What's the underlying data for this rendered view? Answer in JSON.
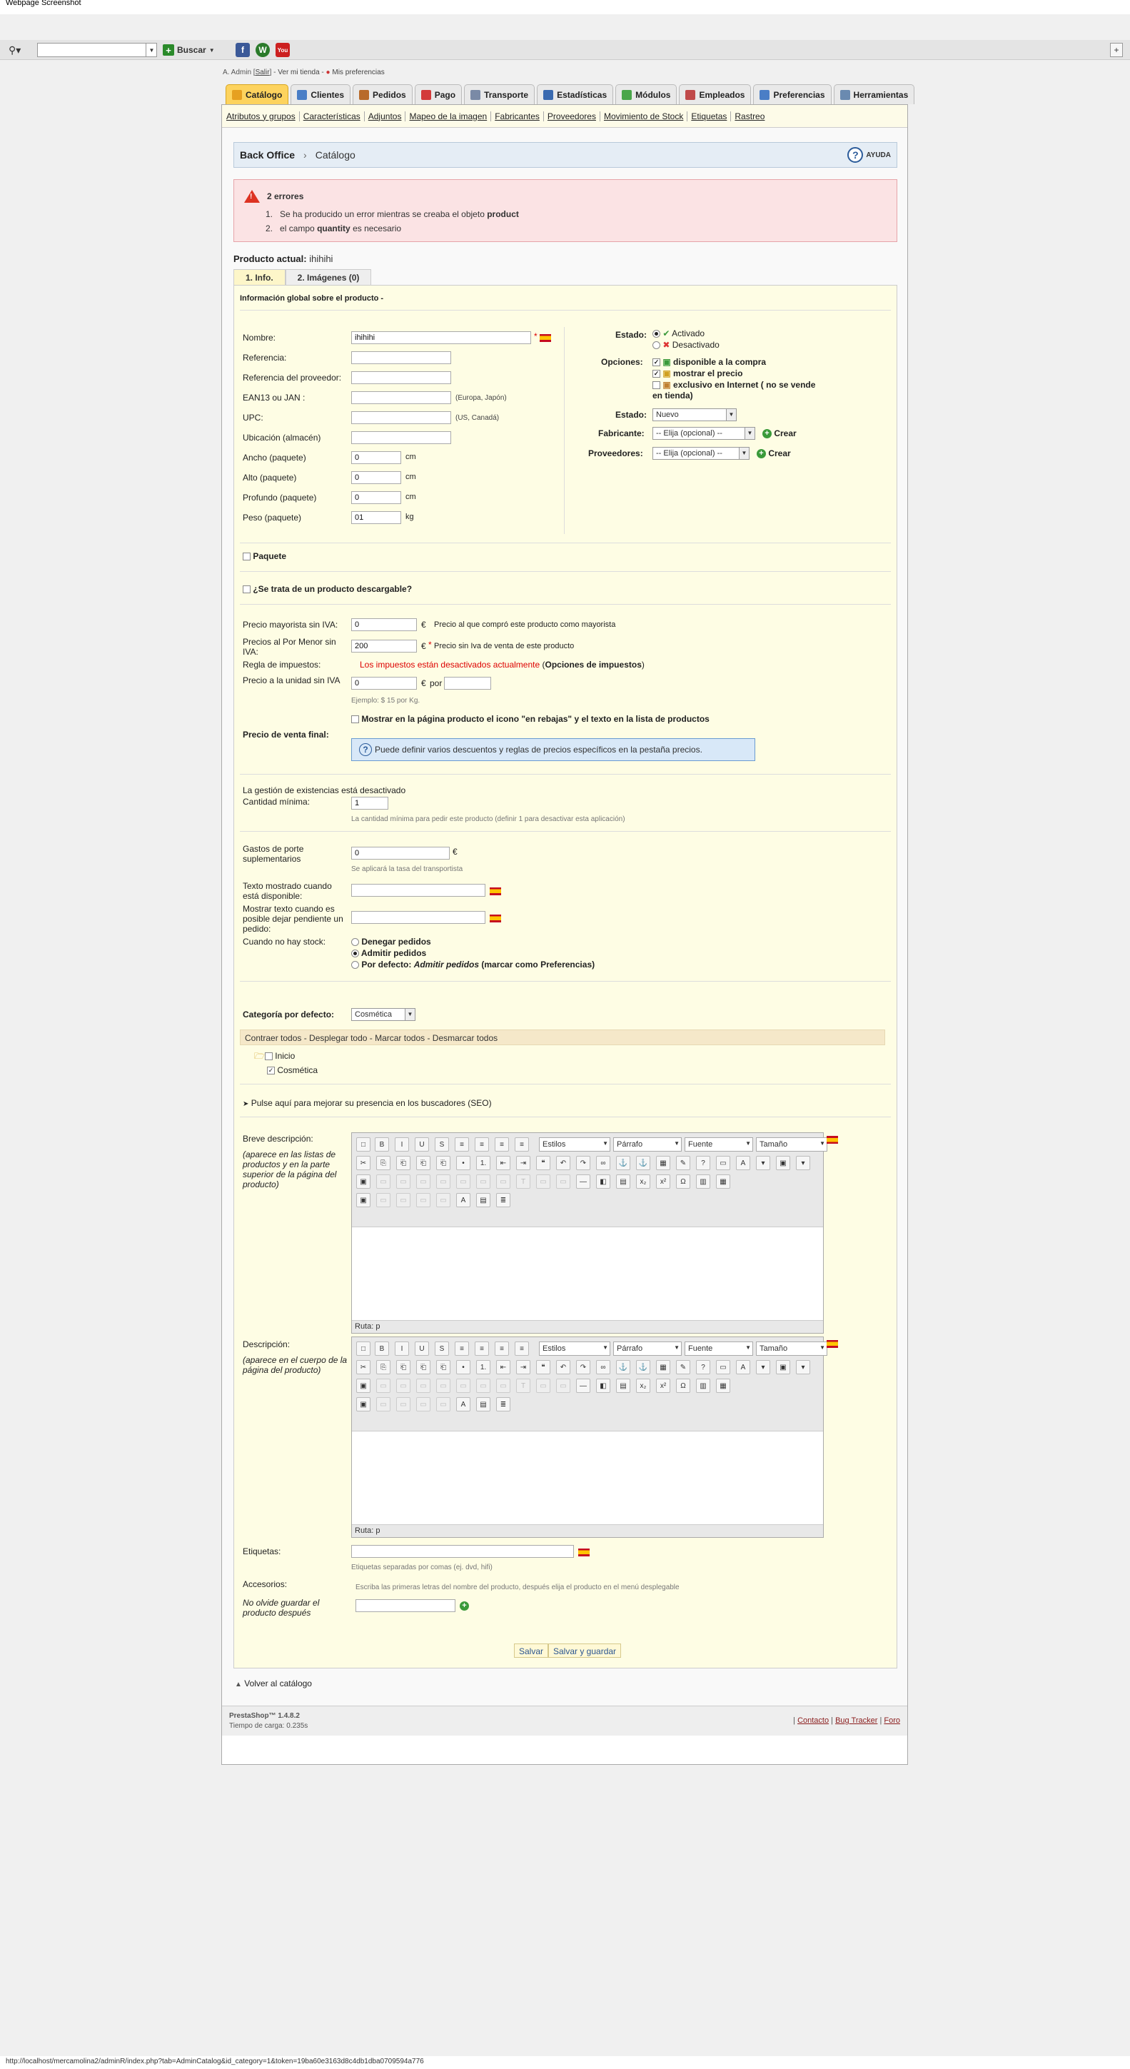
{
  "window": {
    "title": "Webpage Screenshot"
  },
  "toolbar": {
    "search_button": "Buscar"
  },
  "header": {
    "user_prefix": "A. Admin [",
    "logout": "Salir",
    "user_mid": "] - ",
    "view_store": "Ver mi tienda",
    "sep": " - ",
    "preferences": "Mis preferencias"
  },
  "tabs": [
    {
      "label": "Catálogo",
      "color": "#e6a020"
    },
    {
      "label": "Clientes",
      "color": "#4a7ec6"
    },
    {
      "label": "Pedidos",
      "color": "#b86a2a"
    },
    {
      "label": "Pago",
      "color": "#d33a3a"
    },
    {
      "label": "Transporte",
      "color": "#7a8aa6"
    },
    {
      "label": "Estadísticas",
      "color": "#3a6ab0"
    },
    {
      "label": "Módulos",
      "color": "#4aa64a"
    },
    {
      "label": "Empleados",
      "color": "#c04a4a"
    },
    {
      "label": "Preferencias",
      "color": "#4a7ec6"
    },
    {
      "label": "Herramientas",
      "color": "#6a8ab0"
    }
  ],
  "subtabs": [
    "Atributos y grupos",
    "Características",
    "Adjuntos",
    "Mapeo de la imagen",
    "Fabricantes",
    "Proveedores",
    "Movimiento de Stock",
    "Etiquetas",
    "Rastreo"
  ],
  "breadcrumb": {
    "root": "Back Office",
    "current": "Catálogo",
    "help": "AYUDA"
  },
  "errors": {
    "title": "2 errores",
    "items": [
      {
        "num": "1.",
        "text": "Se ha producido un error mientras se creaba el objeto ",
        "bold": "product"
      },
      {
        "num": "2.",
        "text": "el campo ",
        "bold": "quantity",
        "suffix": " es necesario"
      }
    ]
  },
  "product": {
    "current_label": "Producto actual:",
    "current_name": "ihihihi"
  },
  "product_tabs": [
    "1. Info.",
    "2. Imágenes (0)"
  ],
  "form": {
    "section_title": "Información global sobre el producto -",
    "name_label": "Nombre:",
    "name_value": "ihihihi",
    "reference_label": "Referencia:",
    "supplier_ref_label": "Referencia del proveedor:",
    "ean_label": "EAN13 ou JAN :",
    "ean_hint": "(Europa, Japón)",
    "upc_label": "UPC:",
    "upc_hint": "(US, Canadá)",
    "location_label": "Ubicación (almacén)",
    "width_label": "Ancho (paquete)",
    "width_value": "0",
    "width_unit": "cm",
    "height_label": "Alto (paquete)",
    "height_value": "0",
    "height_unit": "cm",
    "depth_label": "Profundo (paquete)",
    "depth_value": "0",
    "depth_unit": "cm",
    "weight_label": "Peso (paquete)",
    "weight_value": "01",
    "weight_unit": "kg",
    "status_label": "Estado:",
    "status_active": "Activado",
    "status_inactive": "Desactivado",
    "options_label": "Opciones:",
    "opt_available": "disponible a la compra",
    "opt_show_price": "mostrar el precio",
    "opt_online_only": "exclusivo en Internet ( no se vende en tienda)",
    "condition_label": "Estado:",
    "condition_value": "Nuevo",
    "manufacturer_label": "Fabricante:",
    "manufacturer_value": "-- Elija (opcional) --",
    "create": "Crear",
    "supplier_label": "Proveedores:",
    "supplier_value": "-- Elija (opcional) --",
    "pack_label": "Paquete",
    "download_label": "¿Se trata de un producto descargable?",
    "wholesale_label": "Precio mayorista sin IVA:",
    "wholesale_value": "0",
    "currency": "€",
    "wholesale_hint": "Precio al que compró este producto como mayorista",
    "retail_label": "Precios al Por Menor sin IVA:",
    "retail_value": "200",
    "retail_hint": "Precio sin Iva de venta de este producto",
    "tax_label": "Regla de impuestos:",
    "tax_disabled": "Los impuestos están desactivados actualmente",
    "tax_open": " (",
    "tax_link": "Opciones de impuestos",
    "tax_close": ")",
    "unit_price_label": "Precio a la unidad sin IVA",
    "unit_price_value": "0",
    "unit_per": "por",
    "unit_hint": "Ejemplo: $ 15 por Kg.",
    "on_sale_label": "Mostrar en la página producto el icono \"en rebajas\" y el texto en la lista de productos",
    "final_price_label": "Precio de venta final:",
    "price_info": "Puede definir varios descuentos y reglas de precios específicos en la pestaña precios.",
    "stock_disabled": "La gestión de existencias está desactivado",
    "min_qty_label": "Cantidad mínima:",
    "min_qty_value": "1",
    "min_qty_hint": "La cantidad mínima para pedir este producto (definir 1 para desactivar esta aplicación)",
    "shipping_label": "Gastos de porte suplementarios",
    "shipping_value": "0",
    "shipping_hint": "Se aplicará la tasa del transportista",
    "available_now_label": "Texto mostrado cuando está disponible:",
    "available_later_label": "Mostrar texto cuando es posible dejar pendiente un pedido:",
    "out_of_stock_label": "Cuando no hay stock:",
    "oos_deny": "Denegar pedidos",
    "oos_allow": "Admitir pedidos",
    "oos_default": "Por defecto: ",
    "oos_default_em": "Admitir pedidos",
    "oos_default_tail": " (marcar como Preferencias)",
    "default_cat_label": "Categoría por defecto:",
    "default_cat_value": "Cosmética",
    "cat_tools": "Contraer todos - Desplegar todo - Marcar todos - Desmarcar todos",
    "cat_home": "Inicio",
    "cat_cosmetics": "Cosmética",
    "seo_label": "Pulse aquí para mejorar su presencia en los buscadores (SEO)",
    "short_desc_label": "Breve descripción:",
    "short_desc_hint": "(aparece en las listas de productos y en la parte superior de la página del producto)",
    "desc_label": "Descripción:",
    "desc_hint": "(aparece en el cuerpo de la página del producto)",
    "editor_styles": "Estilos",
    "editor_format": "Párrafo",
    "editor_font": "Fuente",
    "editor_size": "Tamaño",
    "editor_path": "Ruta: p",
    "tags_label": "Etiquetas:",
    "tags_hint": "Etiquetas separadas por comas (ej. dvd, hifi)",
    "accessories_label": "Accesorios:",
    "accessories_hint": "Escriba las primeras letras del nombre del producto, después elija el producto en el menú desplegable",
    "save_reminder": "No olvide guardar el producto después",
    "save": "Salvar",
    "save_stay": "Salvar y guardar",
    "back": "Volver al catálogo"
  },
  "footer": {
    "version": "PrestaShop™ 1.4.8.2",
    "load_time": "Tiempo de carga: 0.235s",
    "contact": "Contacto",
    "bug": "Bug Tracker",
    "forum": "Foro"
  },
  "statusbar": "http://localhost/mercamolina2/adminR/index.php?tab=AdminCatalog&id_category=1&token=19ba60e3163d8c4db1dba0709594a776"
}
